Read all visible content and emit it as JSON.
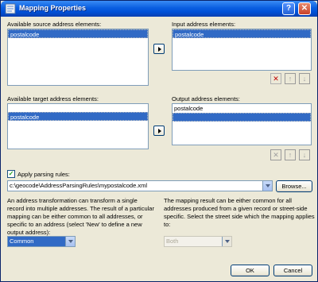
{
  "window": {
    "title": "Mapping Properties",
    "help_label": "?",
    "close_label": "✕"
  },
  "source": {
    "label": "Available source address elements:",
    "items": [
      "postalcode"
    ]
  },
  "input": {
    "label": "Input address elements:",
    "items": [
      "postalcode"
    ]
  },
  "target": {
    "label": "Available target address elements:",
    "items": [
      "postalcode"
    ]
  },
  "output": {
    "label": "Output address elements:",
    "items": [
      "postalcode",
      ""
    ]
  },
  "parsing": {
    "checkbox_label": "Apply parsing rules:",
    "checked": true,
    "path": "c:\\geocode\\AddressParsingRules\\mypostalcode.xml",
    "browse_label": "Browse..."
  },
  "left_text": "An address transformation can transform a single record into multiple addresses.  The result of a particular mapping can be either common to all addresses, or specific to an address (select 'New' to define a new output address):",
  "right_text": "The mapping result can be either common for all addresses produced from a given record or street-side specific. Select the street side which the mapping applies to:",
  "mapping_select": "Common",
  "side_select": "Both",
  "buttons": {
    "ok": "OK",
    "cancel": "Cancel"
  },
  "icons": {
    "move_right": "right-arrow-icon",
    "delete": "delete-x-icon",
    "up": "up-arrow-icon",
    "down": "down-arrow-icon"
  }
}
